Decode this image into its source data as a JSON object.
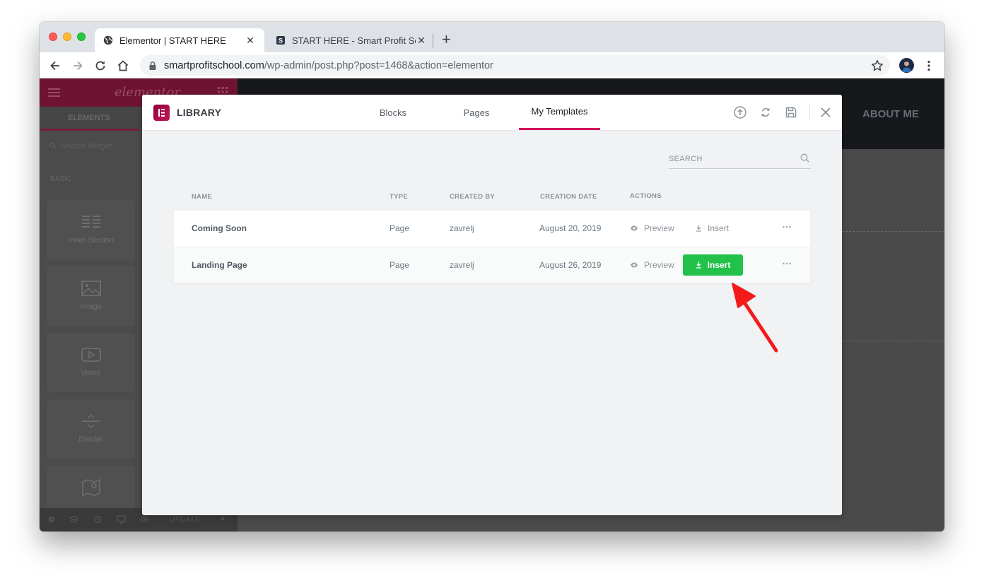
{
  "browser": {
    "tabs": [
      {
        "title": "Elementor | START HERE",
        "icon": "globe-icon",
        "active": true
      },
      {
        "title": "START HERE - Smart Profit School",
        "icon": "site-favicon-icon",
        "active": false
      }
    ],
    "url_host": "smartprofitschool.com",
    "url_path": "/wp-admin/post.php?post=1468&action=elementor"
  },
  "editor": {
    "logo": "elementor",
    "panel_tab": "ELEMENTS",
    "search_placeholder": "Search Widget...",
    "category": "BASIC",
    "widgets": [
      {
        "label": "Inner Section",
        "icon": "inner-section-icon"
      },
      {
        "label": "Image",
        "icon": "image-icon"
      },
      {
        "label": "Video",
        "icon": "video-icon"
      },
      {
        "label": "Divider",
        "icon": "divider-icon"
      },
      {
        "label": "",
        "icon": "map-icon"
      }
    ],
    "footer_update": "UPDATE",
    "canvas_menu_item": "ABOUT ME"
  },
  "library": {
    "title": "LIBRARY",
    "tabs": [
      "Blocks",
      "Pages",
      "My Templates"
    ],
    "active_tab": "My Templates",
    "search_placeholder": "SEARCH",
    "columns": [
      "NAME",
      "TYPE",
      "CREATED BY",
      "CREATION DATE",
      "ACTIONS"
    ],
    "rows": [
      {
        "name": "Coming Soon",
        "type": "Page",
        "created_by": "zavrelj",
        "date": "August 20, 2019",
        "preview": "Preview",
        "insert": "Insert",
        "insert_highlighted": false
      },
      {
        "name": "Landing Page",
        "type": "Page",
        "created_by": "zavrelj",
        "date": "August 26, 2019",
        "preview": "Preview",
        "insert": "Insert",
        "insert_highlighted": true
      }
    ]
  },
  "colors": {
    "accent": "#d30c5c",
    "insert_green": "#22c14a",
    "annotation_arrow": "#f21a1a"
  }
}
